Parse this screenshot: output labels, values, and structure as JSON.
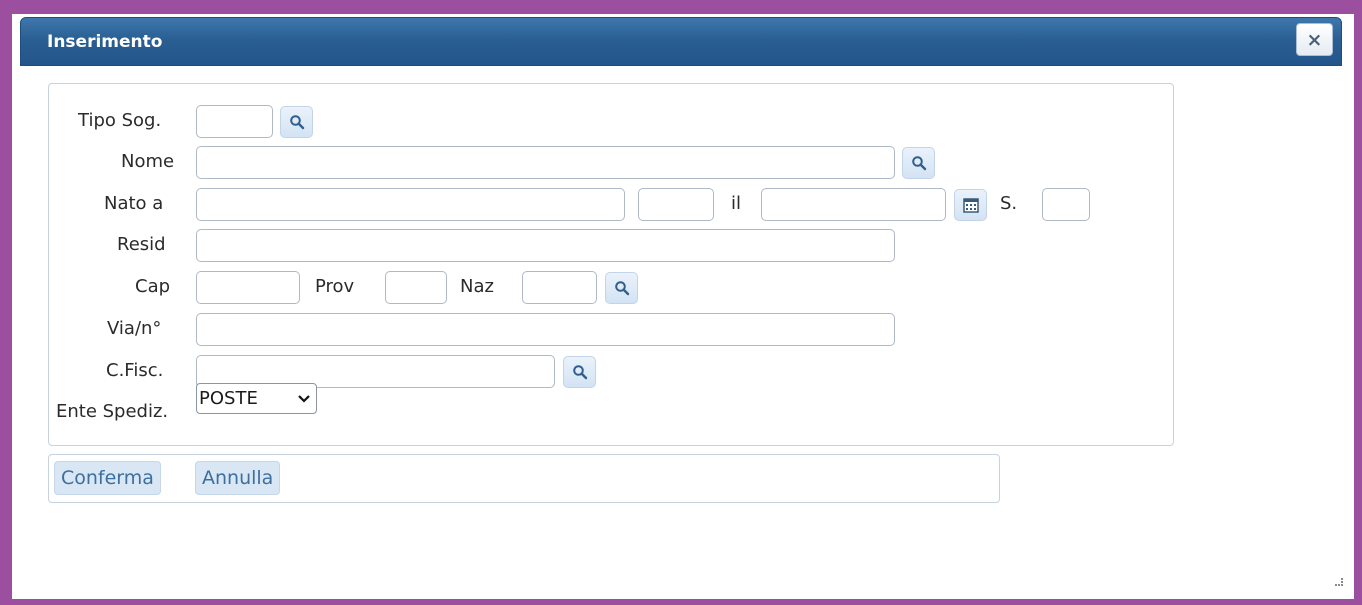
{
  "dialog": {
    "title": "Inserimento",
    "close_label": "×"
  },
  "form": {
    "tipo_sog_label": "Tipo Sog.",
    "nome_label": "Nome",
    "nato_a_label": "Nato a",
    "il_label": "il",
    "s_label": "S.",
    "resid_label": "Resid",
    "cap_label": "Cap",
    "prov_label": "Prov",
    "naz_label": "Naz",
    "via_label": "Via/n°",
    "cfisc_label": "C.Fisc.",
    "ente_label": "Ente Spediz.",
    "ente_value": "POSTE"
  },
  "actions": {
    "confirm_label": "Conferma",
    "cancel_label": "Annulla"
  },
  "colors": {
    "titlebar": "#2a5f93",
    "window_border": "#9b4f9e",
    "button_bg": "#d9e7f5",
    "button_text": "#3d6f9e"
  },
  "icons": {
    "lookup": "magnifier",
    "calendar": "calendar",
    "close": "x"
  }
}
